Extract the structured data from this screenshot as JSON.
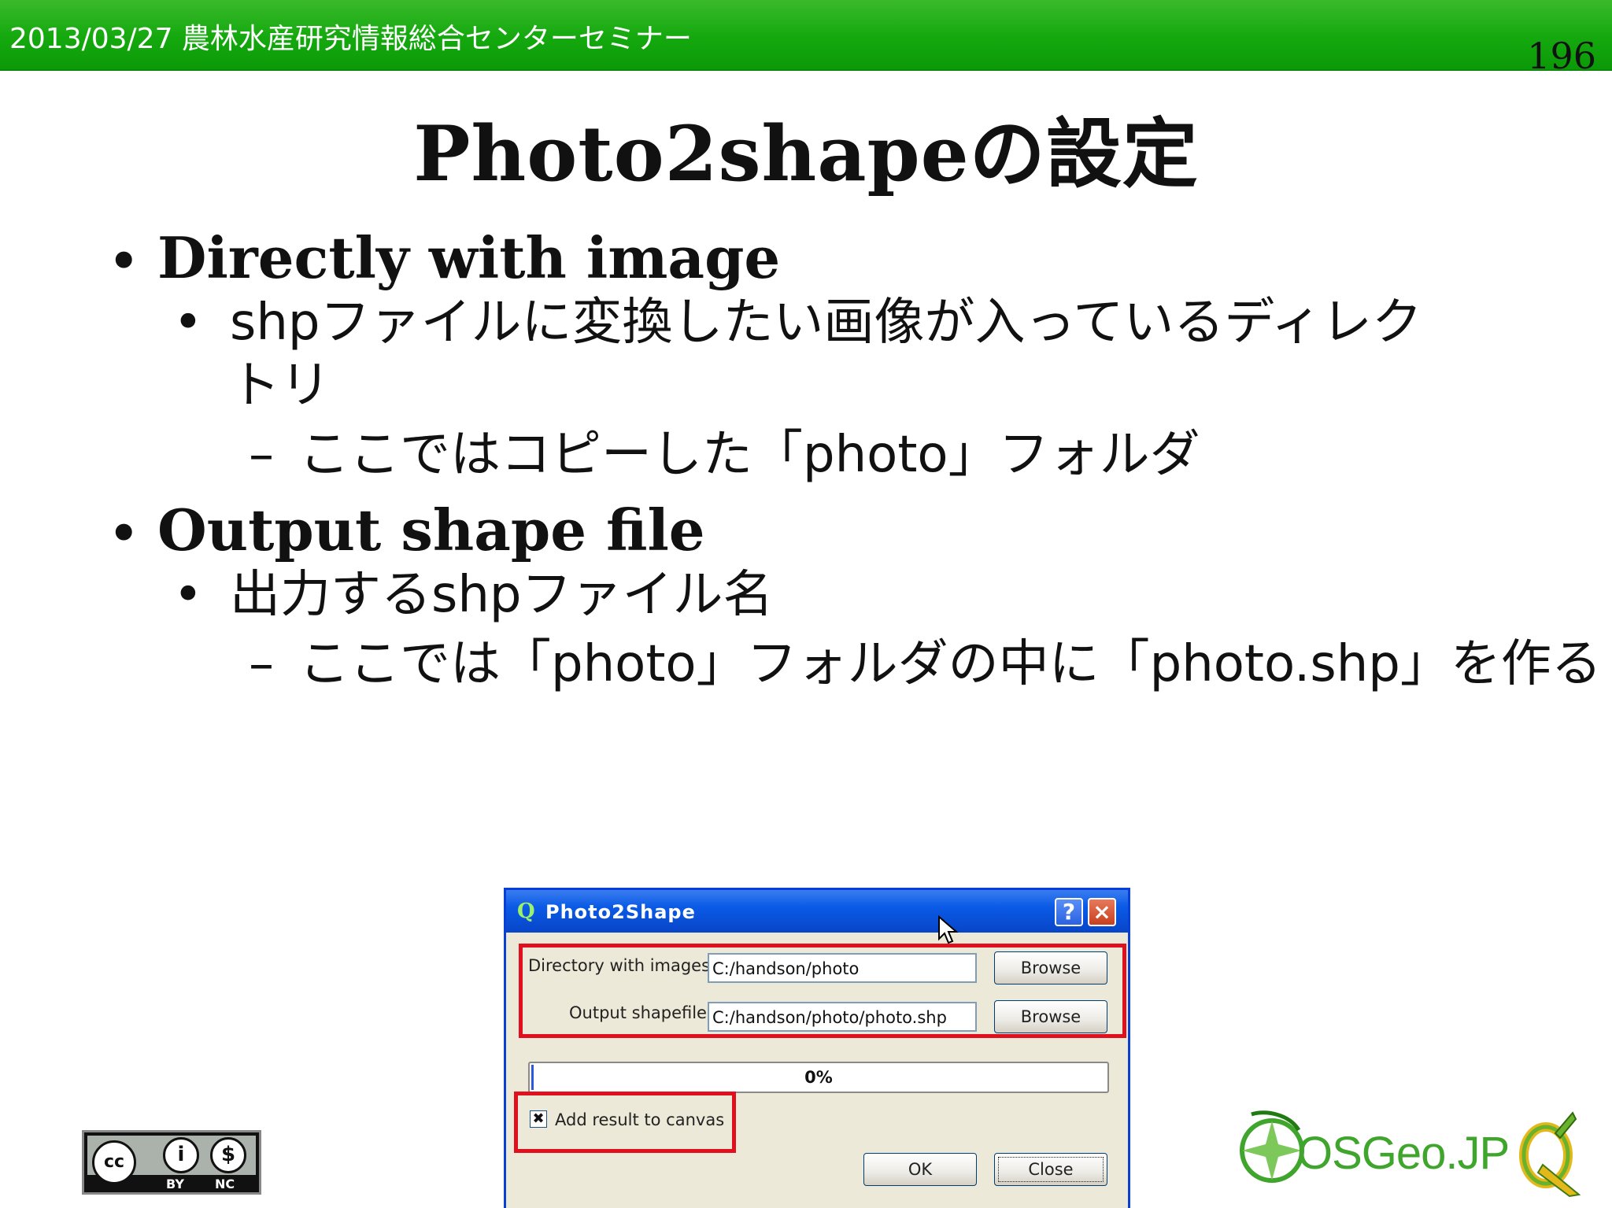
{
  "header": {
    "title": "2013/03/27 農林水産研究情報総合センターセミナー",
    "page_number": "196"
  },
  "slide": {
    "title": "Photo2shapeの設定",
    "bullets": {
      "b1": "Directly with image",
      "b1_1": "shpファイルに変換したい画像が入っているディレク",
      "b1_1_cont": "トリ",
      "b1_1_1": "ここではコピーした「photo」フォルダ",
      "b2": "Output shape file",
      "b2_1": "出力するshpファイル名",
      "b2_1_1": "ここでは「photo」フォルダの中に「photo.shp」を作る"
    }
  },
  "dialog": {
    "title": "Photo2Shape",
    "help_label": "?",
    "close_label": "×",
    "dir_label": "Directory with images",
    "dir_value": "C:/handson/photo",
    "out_label": "Output shapefile",
    "out_value": "C:/handson/photo/photo.shp",
    "browse_label": "Browse",
    "progress_text": "0%",
    "progress_value": 0,
    "checkbox_label": "Add result to canvas",
    "checkbox_checked": true,
    "checkbox_mark": "✖",
    "ok_label": "OK",
    "close_button_label": "Close"
  },
  "footer": {
    "cc_icons": [
      "cc-icon",
      "by-icon",
      "nc-icon"
    ],
    "cc_symbol_cc": "cc",
    "cc_symbol_by": "i",
    "cc_symbol_nc": "$",
    "cc_by": "BY",
    "cc_nc": "NC",
    "osgeo_text": "OSGeo.JP"
  },
  "colors": {
    "header_green": "#14a80e",
    "highlight_red": "#e0101e",
    "xp_blue": "#0a5ae6"
  }
}
